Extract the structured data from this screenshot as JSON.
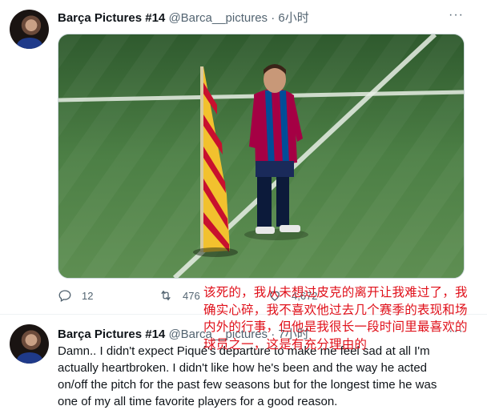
{
  "tweet1": {
    "name": "Barça Pictures #14",
    "handle": "@Barca__pictures",
    "separator": "·",
    "time": "6小时",
    "more_label": "···",
    "actions": {
      "reply_count": "12",
      "retweet_count": "476",
      "like_count": "4,672"
    }
  },
  "tweet2": {
    "name": "Barça Pictures #14",
    "handle": "@Barca__pictures",
    "separator": "·",
    "time": "7小时",
    "more_label": "···",
    "text": "Damn.. I didn't expect Piqué's departure to make me feel sad at all I'm actually heartbroken. I didn't like how he's been and the way he acted on/off the pitch for the past few seasons but for the longest time he was one of my all time favorite players for a good reason."
  },
  "translation_overlay": "该死的，我从未想过皮克的离开让我难过了，我确实心碎，我不喜欢他过去几个赛季的表现和场内外的行事，但他是我很长一段时间里最喜欢的球员之一，这是有充分理由的",
  "colors": {
    "overlay_text": "#e0101a",
    "secondary_text": "#536471",
    "pitch": "#4f7c47"
  },
  "icons": [
    "reply-icon",
    "retweet-icon",
    "like-icon",
    "more-icon"
  ]
}
